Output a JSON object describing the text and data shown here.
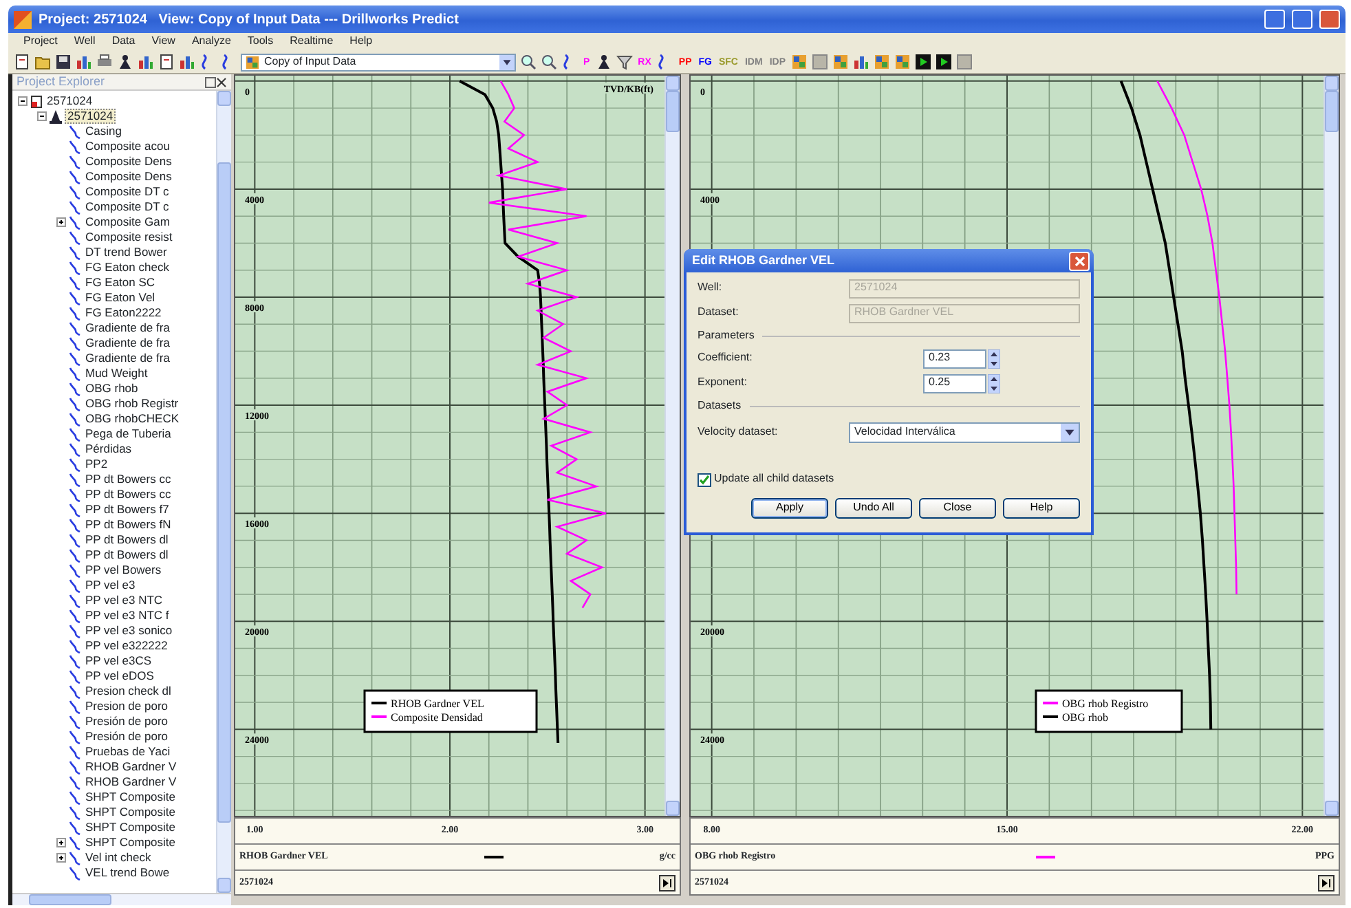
{
  "window": {
    "title": "Project: 2571024   View: Copy of Input Data --- Drillworks Predict"
  },
  "menu": [
    "Project",
    "Well",
    "Data",
    "View",
    "Analyze",
    "Tools",
    "Realtime",
    "Help"
  ],
  "toolbar": {
    "view": "Copy of Input Data",
    "items": [
      {
        "kind": "text",
        "label": "P",
        "color": "#ff00ff"
      },
      {
        "kind": "icon"
      },
      {
        "kind": "icon"
      },
      {
        "kind": "text",
        "label": "RX",
        "color": "#ff00ff"
      },
      {
        "kind": "icon"
      },
      {
        "kind": "text",
        "label": "PP",
        "color": "#ff0000"
      },
      {
        "kind": "text",
        "label": "FG",
        "color": "#0000ff"
      },
      {
        "kind": "text",
        "label": "SFC",
        "color": "#99992a"
      },
      {
        "kind": "text",
        "label": "IDM",
        "color": "#808080"
      },
      {
        "kind": "text",
        "label": "IDP",
        "color": "#808080"
      }
    ]
  },
  "project_explorer": {
    "title": "Project Explorer",
    "tree": [
      {
        "label": "2571024",
        "kind": "project",
        "expanded": true,
        "selected": false,
        "children": [
          {
            "label": "2571024",
            "kind": "well",
            "expanded": true,
            "selected": true,
            "children": [
              {
                "label": "Casing",
                "kind": "dataset",
                "selected": false
              },
              {
                "label": "Composite acou",
                "kind": "dataset",
                "selected": false
              },
              {
                "label": "Composite Dens",
                "kind": "dataset",
                "selected": false
              },
              {
                "label": "Composite Dens",
                "kind": "dataset",
                "selected": false
              },
              {
                "label": "Composite DT c",
                "kind": "dataset",
                "selected": false
              },
              {
                "label": "Composite DT c",
                "kind": "dataset",
                "selected": false
              },
              {
                "label": "Composite Gam",
                "kind": "dataset",
                "expanded": false,
                "selected": false
              },
              {
                "label": "Composite resist",
                "kind": "dataset",
                "selected": false
              },
              {
                "label": "DT trend Bower",
                "kind": "dataset",
                "selected": false
              },
              {
                "label": "FG Eaton check",
                "kind": "dataset",
                "selected": false
              },
              {
                "label": "FG Eaton SC",
                "kind": "dataset",
                "selected": false
              },
              {
                "label": "FG Eaton Vel",
                "kind": "dataset",
                "selected": false
              },
              {
                "label": "FG Eaton2222",
                "kind": "dataset",
                "selected": false
              },
              {
                "label": "Gradiente de fra",
                "kind": "dataset",
                "selected": false
              },
              {
                "label": "Gradiente de fra",
                "kind": "dataset",
                "selected": false
              },
              {
                "label": "Gradiente de fra",
                "kind": "dataset",
                "selected": false
              },
              {
                "label": "Mud Weight",
                "kind": "dataset",
                "selected": false
              },
              {
                "label": "OBG rhob",
                "kind": "dataset",
                "selected": false
              },
              {
                "label": "OBG rhob Registr",
                "kind": "dataset",
                "selected": false
              },
              {
                "label": "OBG rhobCHECK",
                "kind": "dataset",
                "selected": false
              },
              {
                "label": "Pega de Tuberia",
                "kind": "dataset",
                "selected": false
              },
              {
                "label": "Pérdidas",
                "kind": "dataset",
                "selected": false
              },
              {
                "label": "PP2",
                "kind": "dataset",
                "selected": false
              },
              {
                "label": "PP dt Bowers cc",
                "kind": "dataset",
                "selected": false
              },
              {
                "label": "PP dt Bowers cc",
                "kind": "dataset",
                "selected": false
              },
              {
                "label": "PP dt Bowers f7",
                "kind": "dataset",
                "selected": false
              },
              {
                "label": "PP dt Bowers fN",
                "kind": "dataset",
                "selected": false
              },
              {
                "label": "PP dt Bowers dl",
                "kind": "dataset",
                "selected": false
              },
              {
                "label": "PP dt Bowers dl",
                "kind": "dataset",
                "selected": false
              },
              {
                "label": "PP vel Bowers",
                "kind": "dataset",
                "selected": false
              },
              {
                "label": "PP vel e3",
                "kind": "dataset",
                "selected": false
              },
              {
                "label": "PP vel e3 NTC",
                "kind": "dataset",
                "selected": false
              },
              {
                "label": "PP vel e3 NTC f",
                "kind": "dataset",
                "selected": false
              },
              {
                "label": "PP vel e3 sonico",
                "kind": "dataset",
                "selected": false
              },
              {
                "label": "PP vel e322222",
                "kind": "dataset",
                "selected": false
              },
              {
                "label": "PP vel e3CS",
                "kind": "dataset",
                "selected": false
              },
              {
                "label": "PP vel eDOS",
                "kind": "dataset",
                "selected": false
              },
              {
                "label": "Presion check dl",
                "kind": "dataset",
                "selected": false
              },
              {
                "label": "Presion de poro",
                "kind": "dataset",
                "selected": false
              },
              {
                "label": "Presión de poro",
                "kind": "dataset",
                "selected": false
              },
              {
                "label": "Presión de poro",
                "kind": "dataset",
                "selected": false
              },
              {
                "label": "Pruebas de Yaci",
                "kind": "dataset",
                "selected": false
              },
              {
                "label": "RHOB Gardner V",
                "kind": "dataset",
                "selected": false
              },
              {
                "label": "RHOB Gardner V",
                "kind": "dataset",
                "selected": false
              },
              {
                "label": "SHPT Composite",
                "kind": "dataset",
                "selected": false
              },
              {
                "label": "SHPT Composite",
                "kind": "dataset",
                "selected": false
              },
              {
                "label": "SHPT Composite",
                "kind": "dataset",
                "selected": false
              },
              {
                "label": "SHPT Composite",
                "kind": "dataset",
                "expanded": false,
                "selected": false
              },
              {
                "label": "Vel int check",
                "kind": "dataset",
                "expanded": false,
                "selected": false
              },
              {
                "label": "VEL trend Bowe",
                "kind": "dataset",
                "selected": false
              }
            ]
          }
        ]
      }
    ]
  },
  "tracks": [
    {
      "chart_data": {
        "type": "line",
        "ylabel": "TVD/KB(ft)",
        "xlim": [
          0.9,
          3.1
        ],
        "ylim": [
          27200,
          -200
        ],
        "grid": true,
        "legend": true,
        "xticks": [
          {
            "value": 1,
            "label": "1.00"
          },
          {
            "value": 2,
            "label": "2.00"
          },
          {
            "value": 3,
            "label": "3.00"
          }
        ],
        "yticks": [
          {
            "value": 0,
            "label": "0"
          },
          {
            "value": 4000,
            "label": "4000"
          },
          {
            "value": 8000,
            "label": "8000"
          },
          {
            "value": 12000,
            "label": "12000"
          },
          {
            "value": 16000,
            "label": "16000"
          },
          {
            "value": 20000,
            "label": "20000"
          },
          {
            "value": 24000,
            "label": "24000"
          }
        ],
        "series": [
          {
            "name": "RHOB Gardner VEL",
            "color": "#000000",
            "x": [
              2.05,
              2.18,
              2.22,
              2.24,
              2.25,
              2.255,
              2.26,
              2.265,
              2.27,
              2.273,
              2.276,
              2.279,
              2.283,
              2.35,
              2.45,
              2.46,
              2.465,
              2.4677,
              2.4704,
              2.4731,
              2.4758,
              2.4785,
              2.4812,
              2.4839,
              2.4866,
              2.4893,
              2.492,
              2.4947,
              2.4974,
              2.5001,
              2.5028,
              2.5055,
              2.5082,
              2.5109,
              2.5136,
              2.5163,
              2.519,
              2.5217,
              2.5244,
              2.5271,
              2.5298,
              2.5325,
              2.5352,
              2.5379,
              2.5406,
              2.5433,
              2.546,
              2.5487,
              2.5514,
              2.5541
            ],
            "values": [
              0,
              500,
              1000,
              1500,
              2000,
              2500,
              3000,
              3500,
              4000,
              4500,
              5000,
              5500,
              6000,
              6500,
              7000,
              7500,
              8000,
              8500,
              9000,
              9500,
              10000,
              10500,
              11000,
              11500,
              12000,
              12500,
              13000,
              13500,
              14000,
              14500,
              15000,
              15500,
              16000,
              16500,
              17000,
              17500,
              18000,
              18500,
              19000,
              19500,
              20000,
              20500,
              21000,
              21500,
              22000,
              22500,
              23000,
              23500,
              24000,
              24500
            ]
          },
          {
            "name": "Composite Densidad",
            "color": "#ff00ff",
            "x": [
              2.26,
              2.3,
              2.33,
              2.28,
              2.38,
              2.3,
              2.45,
              2.25,
              2.6,
              2.2,
              2.7,
              2.3,
              2.55,
              2.35,
              2.6,
              2.4,
              2.65,
              2.45,
              2.58,
              2.48,
              2.62,
              2.45,
              2.7,
              2.5,
              2.6,
              2.48,
              2.72,
              2.52,
              2.65,
              2.55,
              2.75,
              2.5,
              2.8,
              2.55,
              2.7,
              2.6,
              2.78,
              2.62,
              2.72,
              2.68
            ],
            "values": [
              0,
              500,
              1000,
              1500,
              2000,
              2500,
              3000,
              3500,
              4000,
              4500,
              5000,
              5500,
              6000,
              6500,
              7000,
              7500,
              8000,
              8500,
              9000,
              9500,
              10000,
              10500,
              11000,
              11500,
              12000,
              12500,
              13000,
              13500,
              14000,
              14500,
              15000,
              15500,
              16000,
              16500,
              17000,
              17500,
              18000,
              18500,
              19000,
              19500
            ]
          }
        ]
      },
      "curve": "RHOB Gardner VEL",
      "color": "#000000",
      "unit": "g/cc",
      "well": "2571024"
    },
    {
      "chart_data": {
        "type": "line",
        "xlim": [
          7.5,
          22.5
        ],
        "ylim": [
          27200,
          -200
        ],
        "grid": true,
        "legend": true,
        "xticks": [
          {
            "value": 8,
            "label": "8.00"
          },
          {
            "value": 15,
            "label": "15.00"
          },
          {
            "value": 22,
            "label": "22.00"
          }
        ],
        "yticks": [
          {
            "value": 0,
            "label": "0"
          },
          {
            "value": 4000,
            "label": "4000"
          },
          {
            "value": 20000,
            "label": "20000"
          },
          {
            "value": 24000,
            "label": "24000"
          }
        ],
        "series": [
          {
            "name": "OBG rhob Registro",
            "color": "#ff00ff",
            "x": [
              18.56,
              18.9,
              19.2,
              19.4,
              19.6,
              19.75,
              19.87,
              19.95,
              20.03,
              20.1,
              20.17,
              20.22,
              20.27,
              20.31,
              20.34,
              20.37,
              20.39,
              20.41,
              20.43,
              20.44
            ],
            "values": [
              0,
              1000,
              2000,
              3000,
              4000,
              5000,
              6000,
              7000,
              8000,
              9000,
              10000,
              11000,
              12000,
              13000,
              14000,
              15000,
              16000,
              17000,
              18000,
              19000
            ]
          },
          {
            "name": "OBG rhob",
            "color": "#000000",
            "x": [
              17.7,
              17.95,
              18.15,
              18.3,
              18.45,
              18.6,
              18.75,
              18.85,
              18.95,
              19.05,
              19.15,
              19.22,
              19.3,
              19.38,
              19.45,
              19.52,
              19.58,
              19.63,
              19.67,
              19.71,
              19.74,
              19.77,
              19.8,
              19.82,
              19.83
            ],
            "values": [
              0,
              1000,
              2000,
              3000,
              4000,
              5000,
              6000,
              7000,
              8000,
              9000,
              10000,
              11000,
              12000,
              13000,
              14000,
              15000,
              16000,
              17000,
              18000,
              19000,
              20000,
              21000,
              22000,
              23000,
              24000
            ]
          }
        ]
      },
      "curve": "OBG rhob Registro",
      "color": "#ff00ff",
      "unit": "PPG",
      "well": "2571024"
    }
  ],
  "dialog": {
    "title": "Edit RHOB Gardner VEL",
    "items": [
      {
        "kind": "text",
        "label": "Well:",
        "value": "2571024",
        "disabled": true
      },
      {
        "kind": "text",
        "label": "Dataset:",
        "value": "RHOB Gardner VEL",
        "disabled": true
      },
      {
        "kind": "section",
        "label": "Parameters"
      },
      {
        "kind": "spin",
        "label": "Coefficient:",
        "value": "0.23"
      },
      {
        "kind": "spin",
        "label": "Exponent:",
        "value": "0.25"
      },
      {
        "kind": "section",
        "label": "Datasets"
      },
      {
        "kind": "select",
        "label": "Velocity dataset:",
        "value": "Velocidad Interválica"
      },
      {
        "kind": "checkbox",
        "label": "Update all child datasets",
        "checked": true
      }
    ],
    "buttons": [
      {
        "label": "Apply",
        "default": true
      },
      {
        "label": "Undo All",
        "default": false
      },
      {
        "label": "Close",
        "default": false
      },
      {
        "label": "Help",
        "default": false
      }
    ]
  }
}
